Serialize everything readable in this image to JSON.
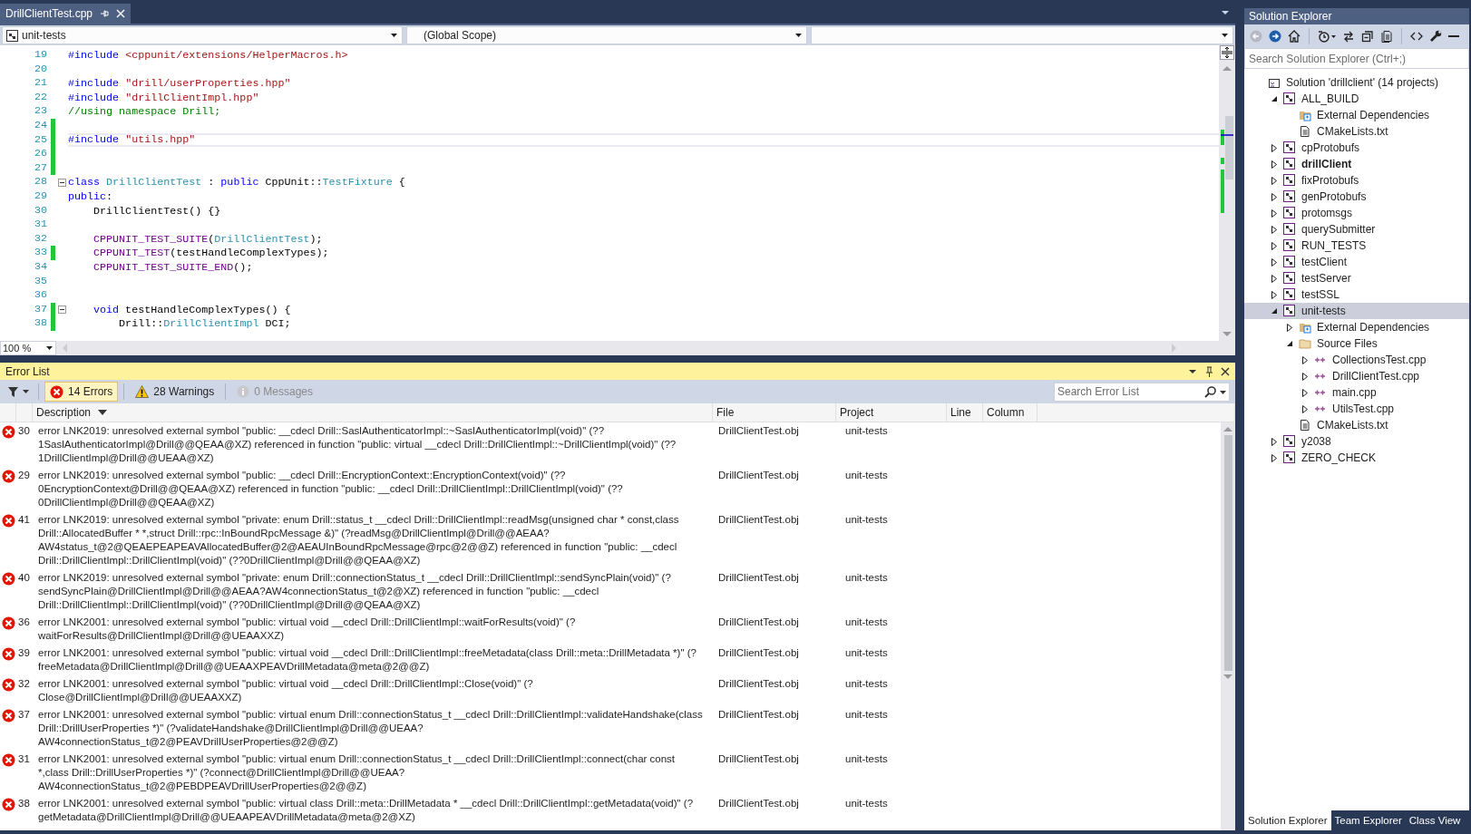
{
  "document_tabs": [
    {
      "label": "DrillClientTest.cpp",
      "selected": true
    }
  ],
  "navigation_bar": {
    "project": "unit-tests",
    "scope": "(Global Scope)"
  },
  "code_lines": [
    {
      "number": "19",
      "changed": false,
      "current": false,
      "fold": false,
      "tokens": [
        {
          "kind": "keyword",
          "text": "#include "
        },
        {
          "kind": "string",
          "text": "<cppunit/extensions/HelperMacros.h>"
        }
      ]
    },
    {
      "number": "20",
      "changed": false,
      "current": false,
      "fold": false
    },
    {
      "number": "21",
      "changed": false,
      "current": false,
      "fold": false,
      "tokens": [
        {
          "kind": "keyword",
          "text": "#include "
        },
        {
          "kind": "string",
          "text": "\"drill/userProperties.hpp\""
        }
      ]
    },
    {
      "number": "22",
      "changed": false,
      "current": false,
      "fold": false,
      "tokens": [
        {
          "kind": "keyword",
          "text": "#include "
        },
        {
          "kind": "string",
          "text": "\"drillClientImpl.hpp\""
        }
      ]
    },
    {
      "number": "23",
      "changed": false,
      "current": false,
      "fold": false,
      "tokens": [
        {
          "kind": "comment",
          "text": "//using namespace Drill;"
        }
      ]
    },
    {
      "number": "24",
      "changed": true,
      "current": false,
      "fold": false
    },
    {
      "number": "25",
      "changed": true,
      "current": true,
      "fold": false,
      "tokens": [
        {
          "kind": "keyword",
          "text": "#include "
        },
        {
          "kind": "string",
          "text": "\"utils.hpp\""
        }
      ]
    },
    {
      "number": "26",
      "changed": true,
      "current": false,
      "fold": false
    },
    {
      "number": "27",
      "changed": true,
      "current": false,
      "fold": false
    },
    {
      "number": "28",
      "changed": false,
      "current": false,
      "fold": true,
      "tokens": [
        {
          "kind": "keyword",
          "text": "class "
        },
        {
          "kind": "type",
          "text": "DrillClientTest"
        },
        {
          "kind": "plain",
          "text": " : "
        },
        {
          "kind": "keyword",
          "text": "public"
        },
        {
          "kind": "plain",
          "text": " CppUnit::"
        },
        {
          "kind": "type",
          "text": "TestFixture"
        },
        {
          "kind": "plain",
          "text": " {"
        }
      ]
    },
    {
      "number": "29",
      "changed": false,
      "current": false,
      "fold": false,
      "tokens": [
        {
          "kind": "keyword",
          "text": "public"
        },
        {
          "kind": "plain",
          "text": ":"
        }
      ]
    },
    {
      "number": "30",
      "changed": false,
      "current": false,
      "fold": false,
      "tokens": [
        {
          "kind": "plain",
          "text": "    DrillClientTest() {}"
        }
      ]
    },
    {
      "number": "31",
      "changed": false,
      "current": false,
      "fold": false
    },
    {
      "number": "32",
      "changed": false,
      "current": false,
      "fold": false,
      "tokens": [
        {
          "kind": "macro",
          "text": "    CPPUNIT_TEST_SUITE"
        },
        {
          "kind": "plain",
          "text": "("
        },
        {
          "kind": "type",
          "text": "DrillClientTest"
        },
        {
          "kind": "plain",
          "text": ");"
        }
      ]
    },
    {
      "number": "33",
      "changed": true,
      "current": false,
      "fold": false,
      "tokens": [
        {
          "kind": "macro",
          "text": "    CPPUNIT_TEST"
        },
        {
          "kind": "plain",
          "text": "(testHandleComplexTypes);"
        }
      ]
    },
    {
      "number": "34",
      "changed": false,
      "current": false,
      "fold": false,
      "tokens": [
        {
          "kind": "macro",
          "text": "    CPPUNIT_TEST_SUITE_END"
        },
        {
          "kind": "plain",
          "text": "();"
        }
      ]
    },
    {
      "number": "35",
      "changed": false,
      "current": false,
      "fold": false
    },
    {
      "number": "36",
      "changed": false,
      "current": false,
      "fold": false
    },
    {
      "number": "37",
      "changed": true,
      "current": false,
      "fold": true,
      "tokens": [
        {
          "kind": "keyword",
          "text": "    void"
        },
        {
          "kind": "plain",
          "text": " testHandleComplexTypes() {"
        }
      ]
    },
    {
      "number": "38",
      "changed": true,
      "current": false,
      "fold": false,
      "tokens": [
        {
          "kind": "plain",
          "text": "        Drill::"
        },
        {
          "kind": "type",
          "text": "DrillClientImpl"
        },
        {
          "kind": "plain",
          "text": " DCI;"
        }
      ]
    }
  ],
  "zoom": "100 %",
  "error_list": {
    "title": "Error List",
    "filters": [
      {
        "kind": "error",
        "label": "14 Errors",
        "selected": true,
        "disabled": false
      },
      {
        "kind": "warning",
        "label": "28 Warnings",
        "selected": false,
        "disabled": false
      },
      {
        "kind": "message",
        "label": "0 Messages",
        "selected": false,
        "disabled": true
      }
    ],
    "search": {
      "placeholder": "Search Error List"
    },
    "columns": [
      {
        "label": "Description",
        "sorted": true
      },
      {
        "label": "File",
        "sorted": false
      },
      {
        "label": "Project",
        "sorted": false
      },
      {
        "label": "Line",
        "sorted": false
      },
      {
        "label": "Column",
        "sorted": false
      }
    ],
    "rows": [
      {
        "kind": "error",
        "code": "30",
        "description": "error LNK2019: unresolved external symbol \"public: __cdecl Drill::SaslAuthenticatorImpl::~SaslAuthenticatorImpl(void)\" (??1SaslAuthenticatorImpl@Drill@@QEAA@XZ) referenced in function \"public: virtual __cdecl Drill::DrillClientImpl::~DrillClientImpl(void)\" (??1DrillClientImpl@Drill@@UEAA@XZ)",
        "file": "DrillClientTest.obj",
        "project": "unit-tests"
      },
      {
        "kind": "error",
        "code": "29",
        "description": "error LNK2019: unresolved external symbol \"public: __cdecl Drill::EncryptionContext::EncryptionContext(void)\" (??0EncryptionContext@Drill@@QEAA@XZ) referenced in function \"public: __cdecl Drill::DrillClientImpl::DrillClientImpl(void)\" (??0DrillClientImpl@Drill@@QEAA@XZ)",
        "file": "DrillClientTest.obj",
        "project": "unit-tests"
      },
      {
        "kind": "error",
        "code": "41",
        "description": "error LNK2019: unresolved external symbol \"private: enum Drill::status_t __cdecl Drill::DrillClientImpl::readMsg(unsigned char * const,class Drill::AllocatedBuffer * *,struct Drill::rpc::InBoundRpcMessage &)\" (?readMsg@DrillClientImpl@Drill@@AEAA?AW4status_t@2@QEAEPEAPEAVAllocatedBuffer@2@AEAUInBoundRpcMessage@rpc@2@@Z) referenced in function \"public: __cdecl Drill::DrillClientImpl::DrillClientImpl(void)\" (??0DrillClientImpl@Drill@@QEAA@XZ)",
        "file": "DrillClientTest.obj",
        "project": "unit-tests"
      },
      {
        "kind": "error",
        "code": "40",
        "description": "error LNK2019: unresolved external symbol \"private: enum Drill::connectionStatus_t __cdecl Drill::DrillClientImpl::sendSyncPlain(void)\" (?sendSyncPlain@DrillClientImpl@Drill@@AEAA?AW4connectionStatus_t@2@XZ) referenced in function \"public: __cdecl Drill::DrillClientImpl::DrillClientImpl(void)\" (??0DrillClientImpl@Drill@@QEAA@XZ)",
        "file": "DrillClientTest.obj",
        "project": "unit-tests"
      },
      {
        "kind": "error",
        "code": "36",
        "description": "error LNK2001: unresolved external symbol \"public: virtual void __cdecl Drill::DrillClientImpl::waitForResults(void)\" (?waitForResults@DrillClientImpl@Drill@@UEAAXXZ)",
        "file": "DrillClientTest.obj",
        "project": "unit-tests"
      },
      {
        "kind": "error",
        "code": "39",
        "description": "error LNK2001: unresolved external symbol \"public: virtual void __cdecl Drill::DrillClientImpl::freeMetadata(class Drill::meta::DrillMetadata *)\" (?freeMetadata@DrillClientImpl@Drill@@UEAAXPEAVDrillMetadata@meta@2@@Z)",
        "file": "DrillClientTest.obj",
        "project": "unit-tests"
      },
      {
        "kind": "error",
        "code": "32",
        "description": "error LNK2001: unresolved external symbol \"public: virtual void __cdecl Drill::DrillClientImpl::Close(void)\" (?Close@DrillClientImpl@Drill@@UEAAXXZ)",
        "file": "DrillClientTest.obj",
        "project": "unit-tests"
      },
      {
        "kind": "error",
        "code": "37",
        "description": "error LNK2001: unresolved external symbol \"public: virtual enum Drill::connectionStatus_t __cdecl Drill::DrillClientImpl::validateHandshake(class Drill::DrillUserProperties *)\" (?validateHandshake@DrillClientImpl@Drill@@UEAA?AW4connectionStatus_t@2@PEAVDrillUserProperties@2@@Z)",
        "file": "DrillClientTest.obj",
        "project": "unit-tests"
      },
      {
        "kind": "error",
        "code": "31",
        "description": "error LNK2001: unresolved external symbol \"public: virtual enum Drill::connectionStatus_t __cdecl Drill::DrillClientImpl::connect(char const *,class Drill::DrillUserProperties *)\" (?connect@DrillClientImpl@Drill@@UEAA?AW4connectionStatus_t@2@PEBDPEAVDrillUserProperties@2@@Z)",
        "file": "DrillClientTest.obj",
        "project": "unit-tests"
      },
      {
        "kind": "error",
        "code": "38",
        "description": "error LNK2001: unresolved external symbol \"public: virtual class Drill::meta::DrillMetadata * __cdecl Drill::DrillClientImpl::getMetadata(void)\" (?getMetadata@DrillClientImpl@Drill@@UEAAPEAVDrillMetadata@meta@2@XZ)",
        "file": "DrillClientTest.obj",
        "project": "unit-tests"
      }
    ]
  },
  "solution_explorer": {
    "title": "Solution Explorer",
    "search": {
      "placeholder": "Search Solution Explorer (Ctrl+;)"
    },
    "tree": [
      {
        "kind": "solution",
        "label": "Solution 'drillclient' (14 projects)",
        "selected": false,
        "children": [
          {
            "kind": "project",
            "label": "ALL_BUILD",
            "selected": false,
            "startup": false,
            "expanded": true,
            "children": [
              {
                "kind": "dependencies",
                "label": "External Dependencies",
                "selected": false
              },
              {
                "kind": "text",
                "label": "CMakeLists.txt",
                "selected": false
              }
            ]
          },
          {
            "kind": "project",
            "label": "cpProtobufs",
            "selected": false,
            "startup": false,
            "expanded": false
          },
          {
            "kind": "project",
            "label": "drillClient",
            "selected": false,
            "startup": true,
            "expanded": false
          },
          {
            "kind": "project",
            "label": "fixProtobufs",
            "selected": false,
            "startup": false,
            "expanded": false
          },
          {
            "kind": "project",
            "label": "genProtobufs",
            "selected": false,
            "startup": false,
            "expanded": false
          },
          {
            "kind": "project",
            "label": "protomsgs",
            "selected": false,
            "startup": false,
            "expanded": false
          },
          {
            "kind": "project",
            "label": "querySubmitter",
            "selected": false,
            "startup": false,
            "expanded": false
          },
          {
            "kind": "project",
            "label": "RUN_TESTS",
            "selected": false,
            "startup": false,
            "expanded": false
          },
          {
            "kind": "project",
            "label": "testClient",
            "selected": false,
            "startup": false,
            "expanded": false
          },
          {
            "kind": "project",
            "label": "testServer",
            "selected": false,
            "startup": false,
            "expanded": false
          },
          {
            "kind": "project",
            "label": "testSSL",
            "selected": false,
            "startup": false,
            "expanded": false
          },
          {
            "kind": "project",
            "label": "unit-tests",
            "selected": true,
            "startup": false,
            "expanded": true,
            "children": [
              {
                "kind": "dependencies",
                "label": "External Dependencies",
                "selected": false,
                "expanded": false
              },
              {
                "kind": "filter",
                "label": "Source Files",
                "selected": false,
                "expanded": true,
                "children": [
                  {
                    "kind": "source",
                    "label": "CollectionsTest.cpp",
                    "selected": false,
                    "expanded": false
                  },
                  {
                    "kind": "source",
                    "label": "DrillClientTest.cpp",
                    "selected": false,
                    "expanded": false
                  },
                  {
                    "kind": "source",
                    "label": "main.cpp",
                    "selected": false,
                    "expanded": false
                  },
                  {
                    "kind": "source",
                    "label": "UtilsTest.cpp",
                    "selected": false,
                    "expanded": false
                  }
                ]
              },
              {
                "kind": "text",
                "label": "CMakeLists.txt",
                "selected": false
              }
            ]
          },
          {
            "kind": "project",
            "label": "y2038",
            "selected": false,
            "startup": false,
            "expanded": false
          },
          {
            "kind": "project",
            "label": "ZERO_CHECK",
            "selected": false,
            "startup": false,
            "expanded": false
          }
        ]
      }
    ],
    "bottom_tabs": [
      {
        "label": "Solution Explorer",
        "selected": true
      },
      {
        "label": "Team Explorer",
        "selected": false
      },
      {
        "label": "Class View",
        "selected": false
      }
    ]
  }
}
